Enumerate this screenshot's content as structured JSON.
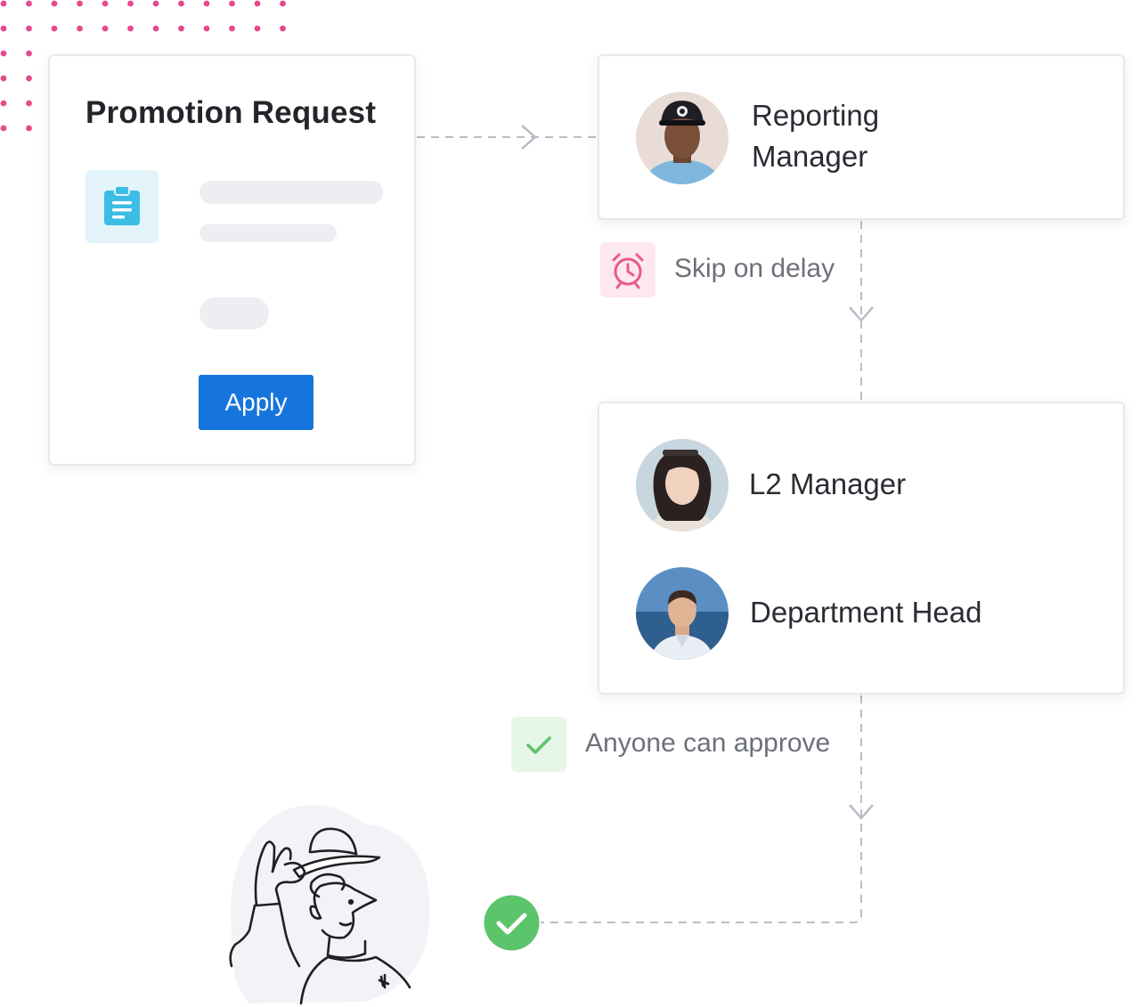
{
  "request_card": {
    "title": "Promotion Request",
    "icon": "clipboard-icon",
    "apply_label": "Apply"
  },
  "steps": [
    {
      "role_lines": [
        "Reporting",
        "Manager"
      ],
      "avatar": "man-in-cap-avatar"
    },
    {
      "role": "L2 Manager",
      "avatar": "woman-avatar"
    },
    {
      "role": "Department Head",
      "avatar": "man-by-sea-avatar"
    }
  ],
  "notes": {
    "skip": {
      "text": "Skip on delay",
      "icon": "alarm-clock-icon"
    },
    "approve": {
      "text": "Anyone can approve",
      "icon": "check-icon"
    }
  },
  "final": {
    "icon": "check-circle-icon"
  },
  "colors": {
    "primary": "#1675dc",
    "dots": "#e64a8c",
    "alarm": "#e85a8a",
    "alarm_bg": "#fde8ee",
    "success": "#5cc46a",
    "success_bg": "#e6f6e8",
    "connector": "#b9bec6",
    "icon_tile_bg": "#e3f3fa",
    "icon_tile_fg": "#3bbde4"
  }
}
